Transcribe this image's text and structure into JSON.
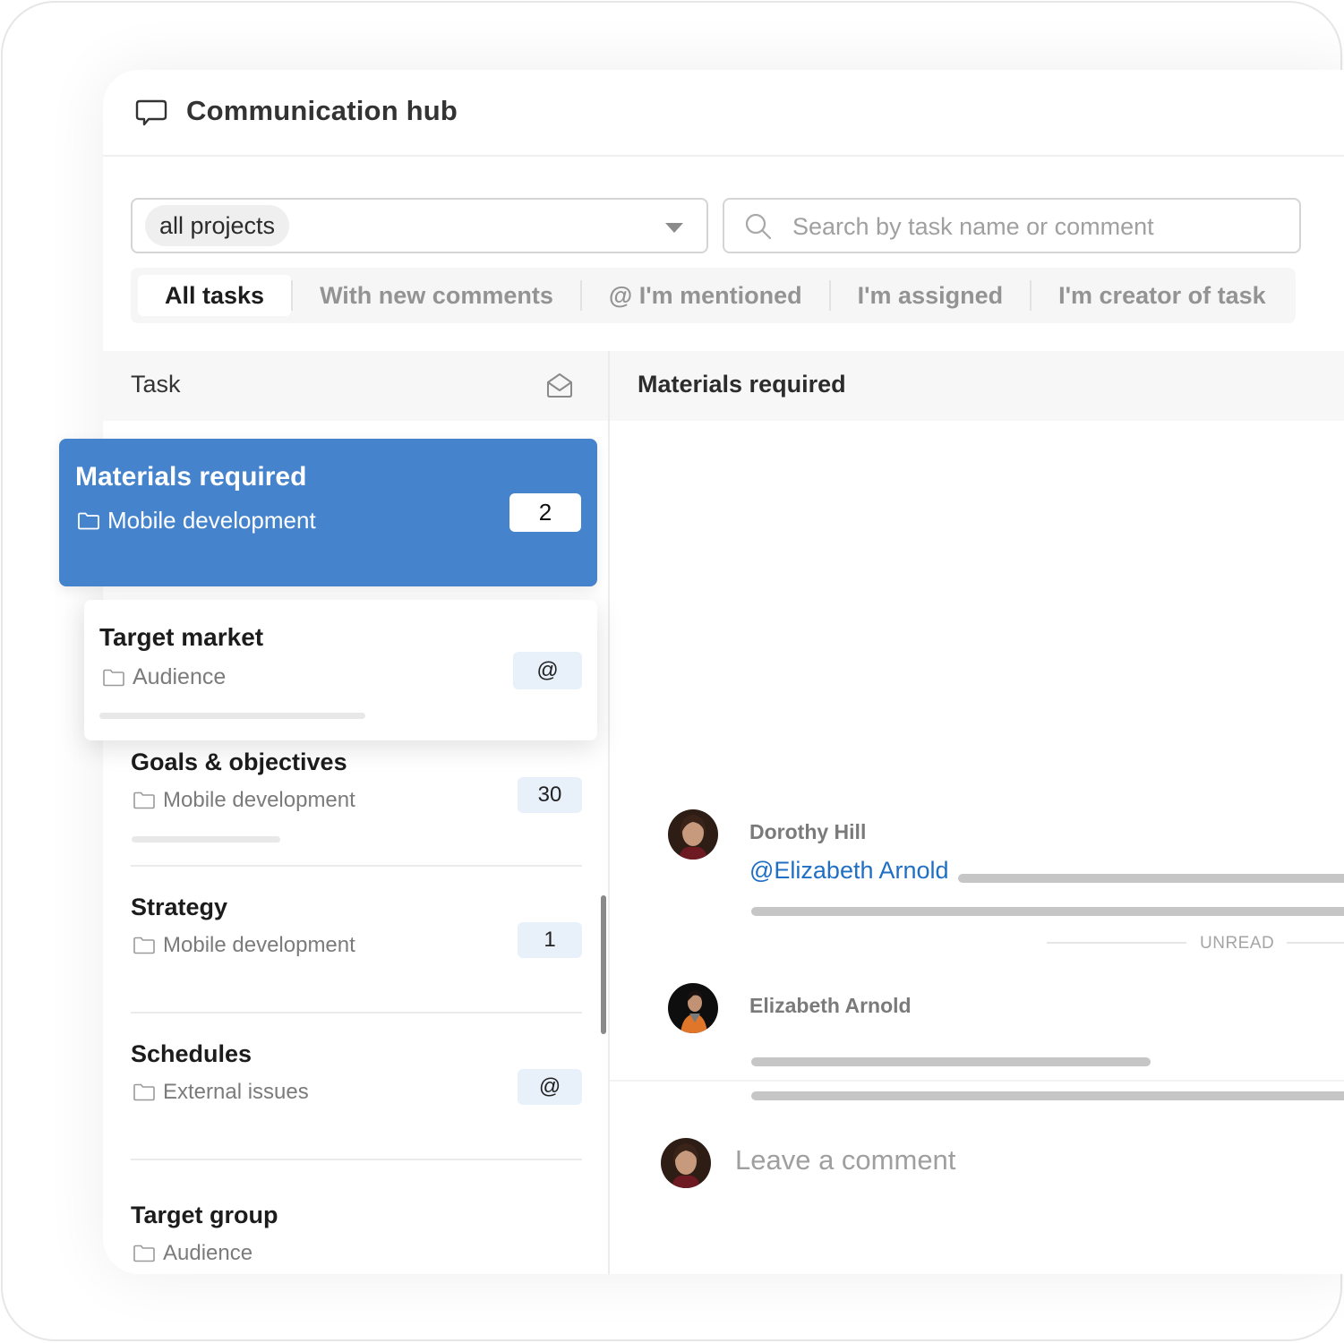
{
  "header": {
    "title": "Communication hub",
    "icon": "speech-bubble-icon"
  },
  "filters": {
    "project_select": {
      "value": "all projects",
      "icon": "chevron-down-icon"
    },
    "search": {
      "placeholder": "Search by task name or comment",
      "value": "",
      "icon": "search-icon"
    }
  },
  "tabs": [
    {
      "label": "All tasks",
      "active": true
    },
    {
      "label": "With new comments",
      "active": false
    },
    {
      "label": "@ I'm mentioned",
      "active": false
    },
    {
      "label": "I'm assigned",
      "active": false
    },
    {
      "label": "I'm creator of task",
      "active": false
    }
  ],
  "task_list": {
    "header_label": "Task",
    "header_icon": "envelope-open-icon",
    "items": [
      {
        "title": "Materials required",
        "project": "Mobile development",
        "badge": "2",
        "state": "selected"
      },
      {
        "title": "Target market",
        "project": "Audience",
        "badge": "@",
        "state": "hovered"
      },
      {
        "title": "Goals & objectives",
        "project": "Mobile development",
        "badge": "30",
        "state": "normal"
      },
      {
        "title": "Strategy",
        "project": "Mobile development",
        "badge": "1",
        "state": "normal"
      },
      {
        "title": "Schedules",
        "project": "External issues",
        "badge": "@",
        "state": "normal"
      },
      {
        "title": "Target group",
        "project": "Audience",
        "badge": "",
        "state": "normal"
      }
    ]
  },
  "detail": {
    "title": "Materials required",
    "comments": [
      {
        "author": "Dorothy Hill",
        "mention": "@Elizabeth Arnold",
        "avatar": "avatar-dorothy-hill"
      },
      {
        "author": "Elizabeth Arnold",
        "mention": "",
        "avatar": "avatar-elizabeth-arnold"
      }
    ],
    "unread_label": "UNREAD",
    "comment_input": {
      "placeholder": "Leave a comment",
      "value": ""
    }
  },
  "colors": {
    "accent": "#4584cc",
    "mention": "#1f6fc5",
    "badge_bg": "#e8f0fa"
  }
}
